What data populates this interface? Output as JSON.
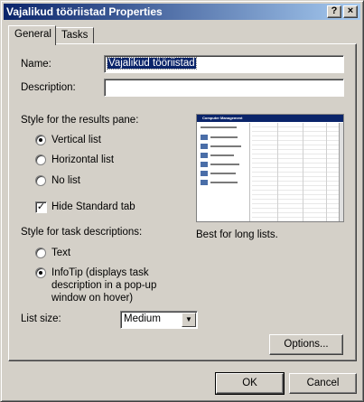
{
  "window": {
    "title": "Vajalikud tööriistad Properties",
    "help_glyph": "?",
    "close_glyph": "×"
  },
  "tabs": [
    {
      "label": "General",
      "active": true
    },
    {
      "label": "Tasks",
      "active": false
    }
  ],
  "form": {
    "name_label": "Name:",
    "name_value": "Vajalikud tööriistad",
    "description_label": "Description:",
    "description_value": "",
    "results_pane_heading": "Style for the results pane:",
    "results_options": [
      {
        "label": "Vertical list",
        "selected": true
      },
      {
        "label": "Horizontal list",
        "selected": false
      },
      {
        "label": "No list",
        "selected": false
      }
    ],
    "hide_standard_tab_label": "Hide Standard tab",
    "hide_standard_tab_checked": true,
    "preview_caption": "Best for long lists.",
    "task_desc_heading": "Style for task descriptions:",
    "task_desc_options": [
      {
        "label": "Text",
        "selected": false
      },
      {
        "label": "InfoTip (displays task description in a pop-up window on hover)",
        "selected": true
      }
    ],
    "infotip_lines": [
      "InfoTip (displays task",
      "description in a pop-up",
      "window on hover)"
    ],
    "list_size_label": "List size:",
    "list_size_value": "Medium",
    "options_button": "Options..."
  },
  "buttons": {
    "ok": "OK",
    "cancel": "Cancel"
  },
  "preview": {
    "window_title": "Computer Management",
    "colors": {
      "titlebar": "#0a246a",
      "selection": "#0a246a"
    }
  },
  "icons": [
    "help-icon",
    "close-icon",
    "radio-selected-icon",
    "radio-unselected-icon",
    "checkbox-checked-icon",
    "dropdown-arrow-icon"
  ]
}
